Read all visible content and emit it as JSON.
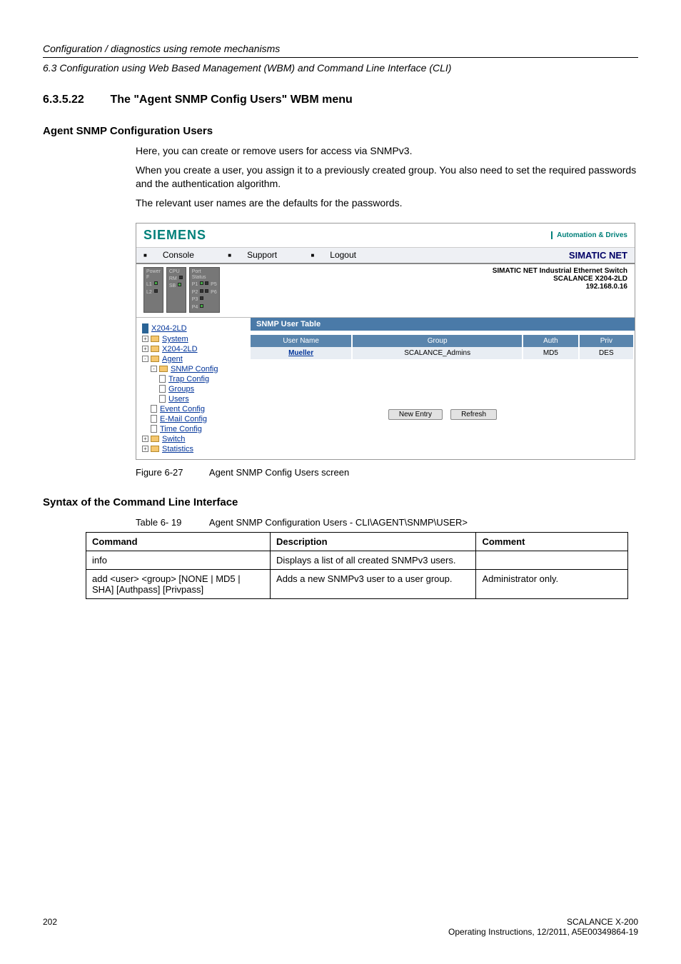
{
  "header": {
    "line1": "Configuration / diagnostics using remote mechanisms",
    "line2": "6.3 Configuration using Web Based Management (WBM) and Command Line Interface (CLI)"
  },
  "section": {
    "number": "6.3.5.22",
    "title": "The \"Agent SNMP Config Users\" WBM menu"
  },
  "h4_config": "Agent SNMP Configuration Users",
  "para1": "Here, you can create or remove users for access via SNMPv3.",
  "para2": "When you create a user, you assign it to a previously created group. You also need to set the required passwords and the authentication algorithm.",
  "para3": "The relevant user names are the defaults for the passwords.",
  "screenshot": {
    "brand": "SIEMENS",
    "tagline": "Automation & Drives",
    "nav": {
      "console": "Console",
      "support": "Support",
      "logout": "Logout"
    },
    "simatic_net": "SIMATIC NET",
    "status_labels": {
      "power": "Power",
      "cpu": "CPU",
      "port": "Port",
      "status": "Status"
    },
    "device_info": {
      "line1": "SIMATIC NET Industrial Ethernet Switch",
      "line2": "SCALANCE X204-2LD",
      "line3": "192.168.0.16"
    },
    "tree": {
      "root": "X204-2LD",
      "system": "System",
      "x204": "X204-2LD",
      "agent": "Agent",
      "snmp_config": "SNMP Config",
      "trap_config": "Trap Config",
      "groups": "Groups",
      "users": "Users",
      "event_config": "Event Config",
      "email_config": "E-Mail Config",
      "time_config": "Time Config",
      "switch": "Switch",
      "statistics": "Statistics"
    },
    "panel_title": "SNMP User Table",
    "table": {
      "headers": {
        "user": "User Name",
        "group": "Group",
        "auth": "Auth",
        "priv": "Priv"
      },
      "row": {
        "user": "Mueller",
        "group": "SCALANCE_Admins",
        "auth": "MD5",
        "priv": "DES"
      }
    },
    "buttons": {
      "new": "New Entry",
      "refresh": "Refresh"
    }
  },
  "fig_caption": {
    "label": "Figure 6-27",
    "text": "Agent SNMP Config Users screen"
  },
  "h4_syntax": "Syntax of the Command Line Interface",
  "table_caption": {
    "label": "Table 6- 19",
    "text": "Agent SNMP Configuration Users - CLI\\AGENT\\SNMP\\USER>"
  },
  "cli_table": {
    "headers": {
      "command": "Command",
      "description": "Description",
      "comment": "Comment"
    },
    "rows": [
      {
        "command": "info",
        "description": "Displays a list of all created SNMPv3 users.",
        "comment": ""
      },
      {
        "command": "add <user> <group> [NONE | MD5 | SHA] [Authpass] [Privpass]",
        "description": "Adds a new SNMPv3 user to a user group.",
        "comment": "Administrator only."
      }
    ]
  },
  "footer": {
    "page": "202",
    "product": "SCALANCE X-200",
    "doc": "Operating Instructions, 12/2011, A5E00349864-19"
  }
}
